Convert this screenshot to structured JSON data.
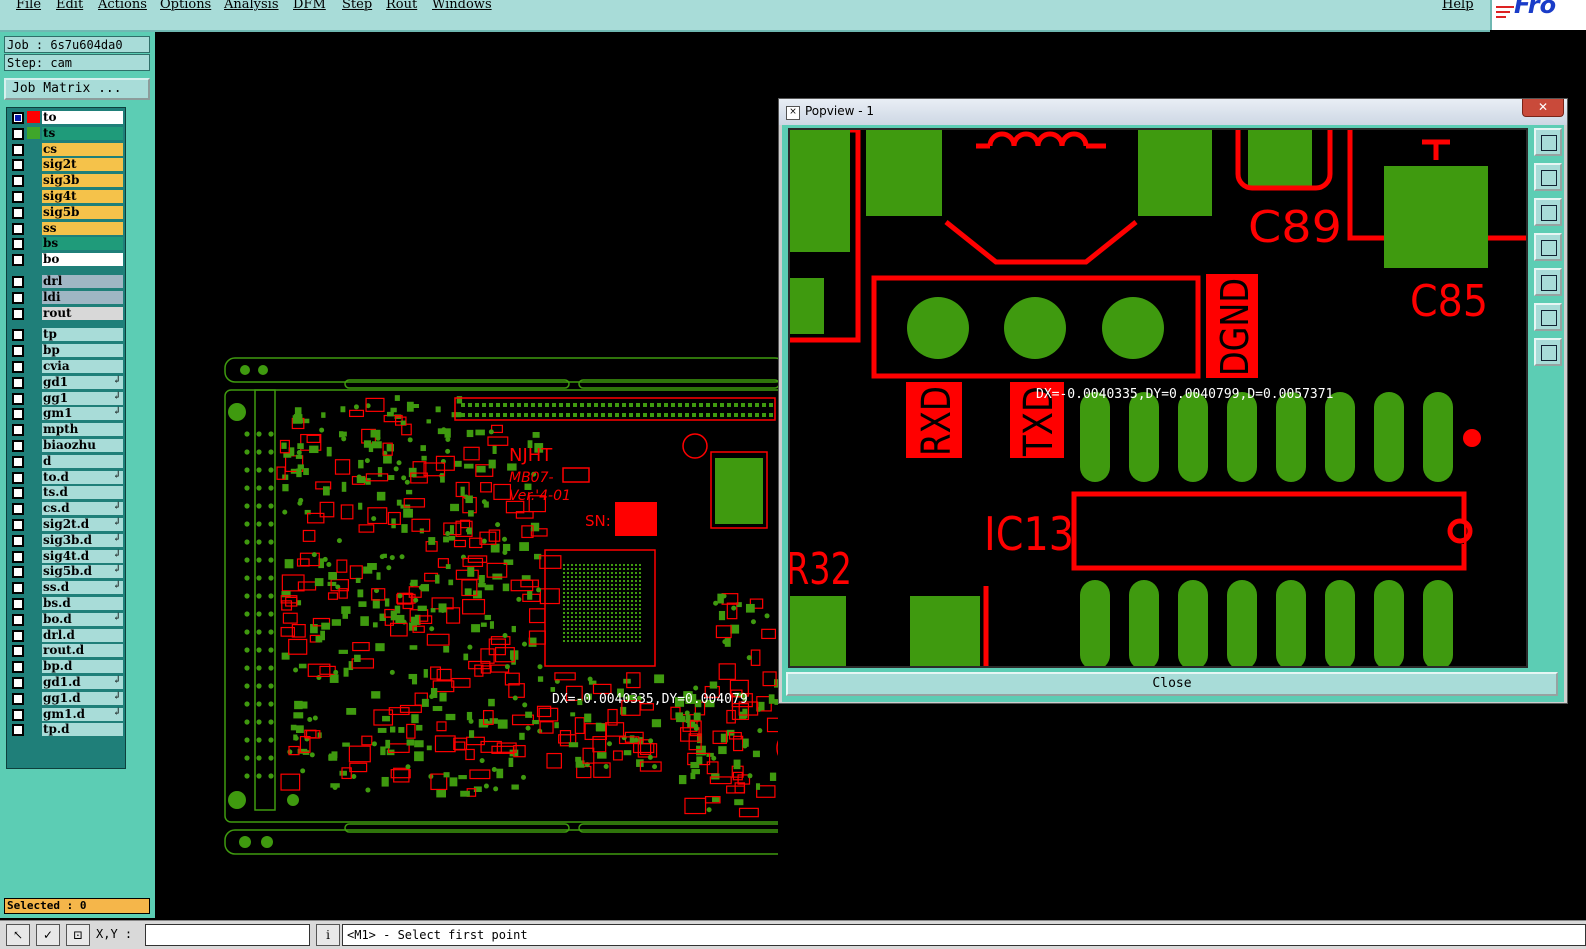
{
  "menubar": {
    "items": [
      "File",
      "Edit",
      "Actions",
      "Options",
      "Analysis",
      "DFM",
      "Step",
      "Rout",
      "Windows"
    ],
    "help": "Help",
    "logo": "Fro"
  },
  "job": {
    "label": "Job : 6s7u604da0",
    "step": "Step: cam",
    "matrix_button": "Job Matrix ..."
  },
  "layers": [
    {
      "name": "to",
      "color": "#ffffff",
      "swatch": "#ff0000",
      "checked": true
    },
    {
      "name": "ts",
      "color": "#1f9b7a",
      "swatch": "#3fa62a",
      "checked": false
    },
    {
      "name": "cs",
      "color": "#f5c24a",
      "checked": false
    },
    {
      "name": "sig2t",
      "color": "#f5c24a",
      "checked": false
    },
    {
      "name": "sig3b",
      "color": "#f5c24a",
      "checked": false
    },
    {
      "name": "sig4t",
      "color": "#f5c24a",
      "checked": false
    },
    {
      "name": "sig5b",
      "color": "#f5c24a",
      "checked": false
    },
    {
      "name": "ss",
      "color": "#f5c24a",
      "checked": false
    },
    {
      "name": "bs",
      "color": "#1f9b7a",
      "checked": false
    },
    {
      "name": "bo",
      "color": "#ffffff",
      "checked": false
    },
    {
      "name": "drl",
      "color": "#9fb6c4",
      "checked": false
    },
    {
      "name": "ldi",
      "color": "#9fb6c4",
      "checked": false
    },
    {
      "name": "rout",
      "color": "#d8d8d8",
      "checked": false
    },
    {
      "name": "tp",
      "color": "#a8dcd8",
      "checked": false
    },
    {
      "name": "bp",
      "color": "#a8dcd8",
      "checked": false
    },
    {
      "name": "cvia",
      "color": "#a8dcd8",
      "checked": false
    },
    {
      "name": "gd1",
      "color": "#a8dcd8",
      "checked": false,
      "arrow": true
    },
    {
      "name": "gg1",
      "color": "#a8dcd8",
      "checked": false,
      "arrow": true
    },
    {
      "name": "gm1",
      "color": "#a8dcd8",
      "checked": false,
      "arrow": true
    },
    {
      "name": "mpth",
      "color": "#a8dcd8",
      "checked": false
    },
    {
      "name": "biaozhu",
      "color": "#a8dcd8",
      "checked": false
    },
    {
      "name": "d",
      "color": "#a8dcd8",
      "checked": false
    },
    {
      "name": "to.d",
      "color": "#a8dcd8",
      "checked": false,
      "arrow": true
    },
    {
      "name": "ts.d",
      "color": "#a8dcd8",
      "checked": false
    },
    {
      "name": "cs.d",
      "color": "#a8dcd8",
      "checked": false,
      "arrow": true
    },
    {
      "name": "sig2t.d",
      "color": "#a8dcd8",
      "checked": false,
      "arrow": true
    },
    {
      "name": "sig3b.d",
      "color": "#a8dcd8",
      "checked": false,
      "arrow": true
    },
    {
      "name": "sig4t.d",
      "color": "#a8dcd8",
      "checked": false,
      "arrow": true
    },
    {
      "name": "sig5b.d",
      "color": "#a8dcd8",
      "checked": false,
      "arrow": true
    },
    {
      "name": "ss.d",
      "color": "#a8dcd8",
      "checked": false,
      "arrow": true
    },
    {
      "name": "bs.d",
      "color": "#a8dcd8",
      "checked": false
    },
    {
      "name": "bo.d",
      "color": "#a8dcd8",
      "checked": false,
      "arrow": true
    },
    {
      "name": "drl.d",
      "color": "#a8dcd8",
      "checked": false
    },
    {
      "name": "rout.d",
      "color": "#a8dcd8",
      "checked": false
    },
    {
      "name": "bp.d",
      "color": "#a8dcd8",
      "checked": false
    },
    {
      "name": "gd1.d",
      "color": "#a8dcd8",
      "checked": false,
      "arrow": true
    },
    {
      "name": "gg1.d",
      "color": "#a8dcd8",
      "checked": false,
      "arrow": true
    },
    {
      "name": "gm1.d",
      "color": "#a8dcd8",
      "checked": false,
      "arrow": true
    },
    {
      "name": "tp.d",
      "color": "#a8dcd8",
      "checked": false
    }
  ],
  "selected": "Selected : 0",
  "board": {
    "silk_text": [
      "NJHT",
      "MB07-",
      "Ver.'4-01",
      "SN:"
    ],
    "measurement": "DX=-0.0040335,DY=0.004079"
  },
  "popview": {
    "title": "Popview - 1",
    "close_x": "✕",
    "close_button": "Close",
    "labels": [
      "C89",
      "C85",
      "DGND",
      "RXD",
      "TXD",
      "IC13",
      "R32"
    ],
    "measurement": "DX=-0.0040335,DY=0.0040799,D=0.0057371"
  },
  "statusbar": {
    "xy_label": "X,Y :",
    "prompt": "<M1> - Select first point"
  },
  "colors": {
    "copper": "#ff0000",
    "pad": "#3f9a0f",
    "board_bg": "#000000",
    "ui_bg": "#a8dcd8",
    "panel": "#5ccdb4"
  }
}
